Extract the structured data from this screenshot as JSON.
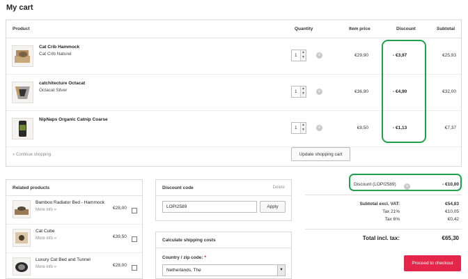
{
  "page_title": "My cart",
  "cart": {
    "headers": {
      "product": "Product",
      "quantity": "Quantity",
      "item_price": "Item price",
      "discount": "Discount",
      "subtotal": "Subtotal"
    },
    "items": [
      {
        "name": "Cat Crib Hammock",
        "variant": "Cat Crib Naturel",
        "qty": "1",
        "price": "€29,90",
        "discount": "- €3,97",
        "subtotal": "€25,93"
      },
      {
        "name": "catchitecture Octacat",
        "variant": "Octacat Silver",
        "qty": "1",
        "price": "€36,90",
        "discount": "- €4,90",
        "subtotal": "€32,00"
      },
      {
        "name": "NipNaps Organic Catnip Coarse",
        "variant": "",
        "qty": "1",
        "price": "€8,50",
        "discount": "- €1,13",
        "subtotal": "€7,37"
      }
    ],
    "continue_label": "« Continue shopping",
    "update_label": "Update shopping cart"
  },
  "related": {
    "title": "Related products",
    "items": [
      {
        "name": "Bamboo Radiator Bed - Hammock",
        "more": "More info »",
        "price": "€28,00"
      },
      {
        "name": "Cat Cube",
        "more": "More info »",
        "price": "€39,50"
      },
      {
        "name": "Luxury Cat Bed and Tunnel",
        "more": "More info »",
        "price": "€28,00"
      }
    ]
  },
  "discount_code": {
    "title": "Discount code",
    "delete_label": "Delete",
    "value": "LOPI2589",
    "apply_label": "Apply"
  },
  "shipping": {
    "title": "Calculate shipping costs",
    "country_label": "Country / zip code:",
    "required_mark": "*",
    "country_value": "Netherlands, The"
  },
  "totals": {
    "discount_label": "Discount (LOPI2589)",
    "discount_value": "- €10,00",
    "subtotal_label": "Subtotal excl. VAT:",
    "subtotal_value": "€54,83",
    "tax21_label": "Tax 21%",
    "tax21_value": "€10,05",
    "tax6_label": "Tax 6%",
    "tax6_value": "€0,42",
    "total_label": "Total incl. tax:",
    "total_value": "€65,30",
    "checkout_label": "Proceed to checkout"
  },
  "colors": {
    "highlight": "#1ea14a",
    "checkout": "#e4264a"
  }
}
